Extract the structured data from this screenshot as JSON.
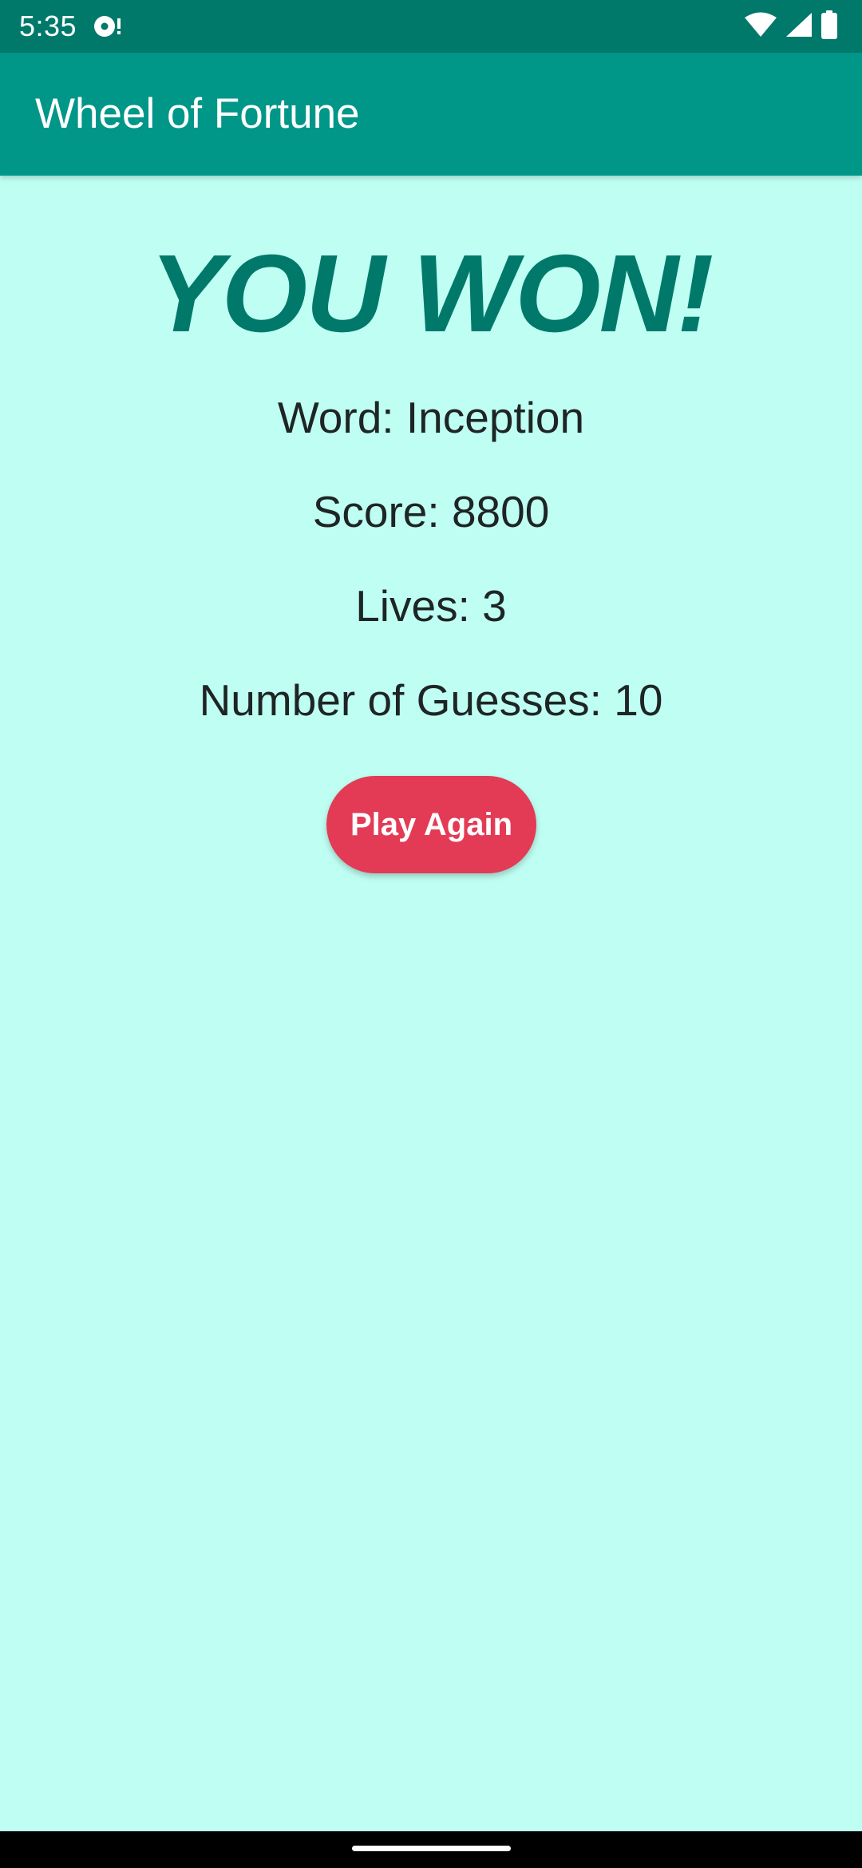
{
  "status_bar": {
    "time": "5:35",
    "left_icon": "media-status-icon",
    "right_icons": [
      "wifi-icon",
      "cellular-signal-icon",
      "battery-icon"
    ]
  },
  "app_bar": {
    "title": "Wheel of Fortune"
  },
  "result": {
    "headline": "YOU WON!",
    "word": "Word: Inception",
    "score": "Score: 8800",
    "lives": "Lives: 3",
    "guesses": "Number of Guesses: 10"
  },
  "actions": {
    "play_again_label": "Play Again"
  },
  "colors": {
    "status_bar": "#00796B",
    "app_bar": "#009688",
    "background": "#BFFFF3",
    "headline": "#00796B",
    "button": "#E33B55",
    "text": "#1E2524"
  }
}
